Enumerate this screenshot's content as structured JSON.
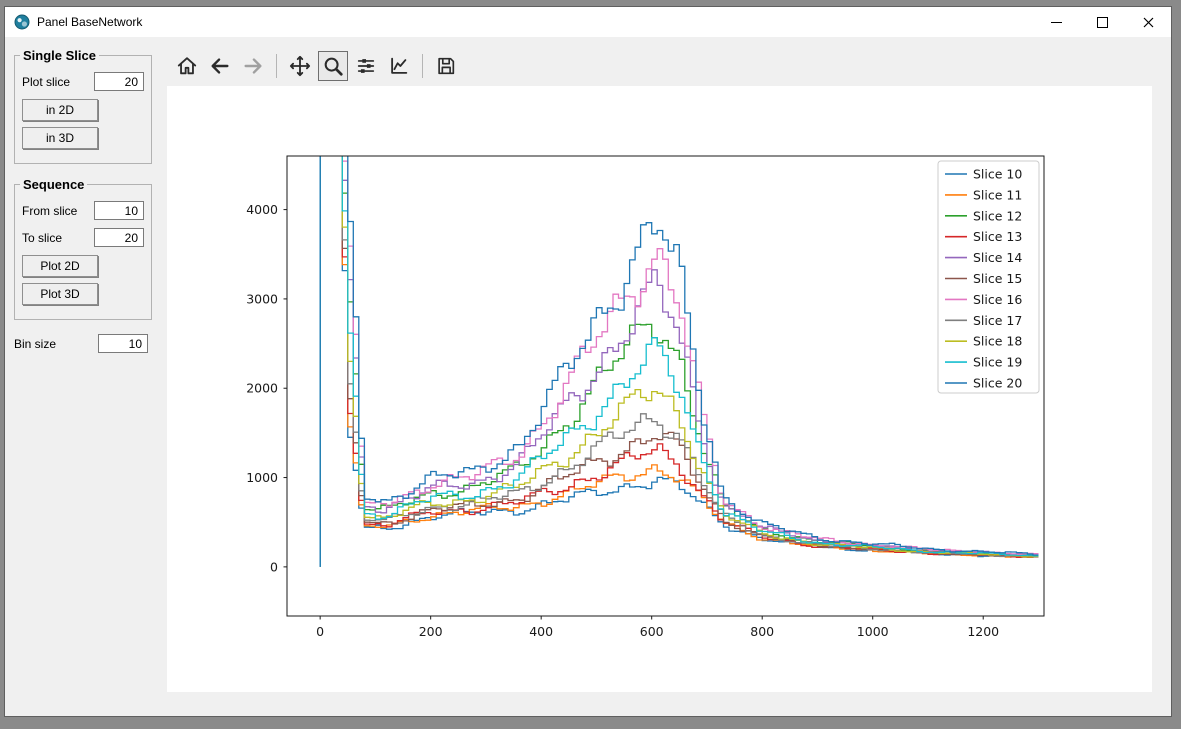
{
  "window": {
    "title": "Panel BaseNetwork",
    "icon": "app-logo-icon",
    "controls": {
      "minimize": "minimize-icon",
      "maximize": "maximize-icon",
      "close": "close-icon"
    }
  },
  "sidebar": {
    "single_slice": {
      "title": "Single Slice",
      "plot_slice_label": "Plot slice",
      "plot_slice_value": "20",
      "in_2d_button": "in 2D",
      "in_3d_button": "in 3D"
    },
    "sequence": {
      "title": "Sequence",
      "from_slice_label": "From slice",
      "from_slice_value": "10",
      "to_slice_label": "To slice",
      "to_slice_value": "20",
      "plot_2d_button": "Plot 2D",
      "plot_3d_button": "Plot 3D"
    },
    "bin_size_label": "Bin size",
    "bin_size_value": "10"
  },
  "toolbar": {
    "tools": [
      {
        "name": "home-icon"
      },
      {
        "name": "back-icon"
      },
      {
        "name": "forward-icon"
      },
      {
        "name": "pan-icon"
      },
      {
        "name": "zoom-icon"
      },
      {
        "name": "subplots-icon"
      },
      {
        "name": "customize-icon"
      },
      {
        "name": "save-icon"
      }
    ],
    "active_tool": "zoom"
  },
  "chart_data": {
    "type": "line",
    "subtype": "histogram-step",
    "background": "#ffffff",
    "xlim": [
      -60,
      1310
    ],
    "ylim": [
      -550,
      4600
    ],
    "xticks": [
      0,
      200,
      400,
      600,
      800,
      1000,
      1200
    ],
    "yticks": [
      0,
      1000,
      2000,
      3000,
      4000
    ],
    "xlabel": "",
    "ylabel": "",
    "grid": false,
    "legend_position": "upper right",
    "bin_width": 10,
    "x_anchors": [
      0,
      40,
      50,
      65,
      80,
      120,
      200,
      280,
      360,
      440,
      520,
      580,
      610,
      650,
      690,
      730,
      800,
      900,
      1100,
      1300
    ],
    "series": [
      {
        "name": "Slice 10",
        "color": "#1f77b4",
        "values": [
          5000,
          5000,
          1635,
          1081,
          446,
          434,
          561,
          604,
          643,
          743,
          856,
          943,
          980,
          896,
          709,
          481,
          316,
          223,
          148,
          106
        ]
      },
      {
        "name": "Slice 11",
        "color": "#ff7f0e",
        "values": [
          5000,
          5000,
          1768,
          1164,
          461,
          448,
          582,
          626,
          677,
          808,
          957,
          1071,
          1120,
          1010,
          764,
          495,
          324,
          228,
          150,
          108
        ]
      },
      {
        "name": "Slice 12",
        "color": "#2ca02c",
        "values": [
          5000,
          5000,
          3370,
          2160,
          643,
          626,
          824,
          890,
          1087,
          1595,
          2170,
          2611,
          2800,
          2374,
          1425,
          669,
          419,
          284,
          181,
          127
        ]
      },
      {
        "name": "Slice 13",
        "color": "#d62728",
        "values": [
          5000,
          5000,
          1940,
          1271,
          481,
          467,
          608,
          654,
          721,
          892,
          1087,
          1236,
          1300,
          1156,
          835,
          514,
          334,
          234,
          153,
          110
        ]
      },
      {
        "name": "Slice 14",
        "color": "#9467bd",
        "values": [
          5000,
          5000,
          3656,
          2338,
          676,
          658,
          867,
          937,
          1160,
          1735,
          2386,
          2886,
          3100,
          2618,
          1543,
          700,
          436,
          294,
          186,
          131
        ]
      },
      {
        "name": "Slice 15",
        "color": "#8c564b",
        "values": [
          5000,
          5000,
          2130,
          1389,
          502,
          489,
          636,
          686,
          770,
          986,
          1231,
          1419,
          1500,
          1318,
          914,
          535,
          345,
          240,
          157,
          112
        ]
      },
      {
        "name": "Slice 16",
        "color": "#e377c2",
        "values": [
          5000,
          5000,
          4085,
          2604,
          724,
          705,
          932,
          1008,
          1270,
          1946,
          2711,
          3298,
          3550,
          2983,
          1720,
          746,
          461,
          309,
          194,
          136
        ]
      },
      {
        "name": "Slice 17",
        "color": "#7f7f7f",
        "values": [
          5000,
          5000,
          2321,
          1508,
          524,
          510,
          665,
          717,
          818,
          1080,
          1376,
          1603,
          1700,
          1481,
          992,
          555,
          356,
          247,
          161,
          115
        ]
      },
      {
        "name": "Slice 18",
        "color": "#bcbd22",
        "values": [
          5000,
          5000,
          2607,
          1686,
          557,
          541,
          709,
          764,
          891,
          1220,
          1592,
          1878,
          2000,
          1724,
          1110,
          586,
          373,
          257,
          166,
          118
        ]
      },
      {
        "name": "Slice 19",
        "color": "#17becf",
        "values": [
          5000,
          5000,
          2970,
          1911,
          598,
          582,
          763,
          824,
          984,
          1398,
          1867,
          2226,
          2380,
          2033,
          1260,
          625,
          395,
          270,
          173,
          123
        ]
      },
      {
        "name": "Slice 20",
        "color": "#1f77b4",
        "values": [
          5000,
          5000,
          4400,
          2800,
          760,
          740,
          980,
          1060,
          1350,
          2100,
          2950,
          3600,
          3880,
          3250,
          1850,
          780,
          480,
          320,
          200,
          140
        ]
      }
    ]
  }
}
